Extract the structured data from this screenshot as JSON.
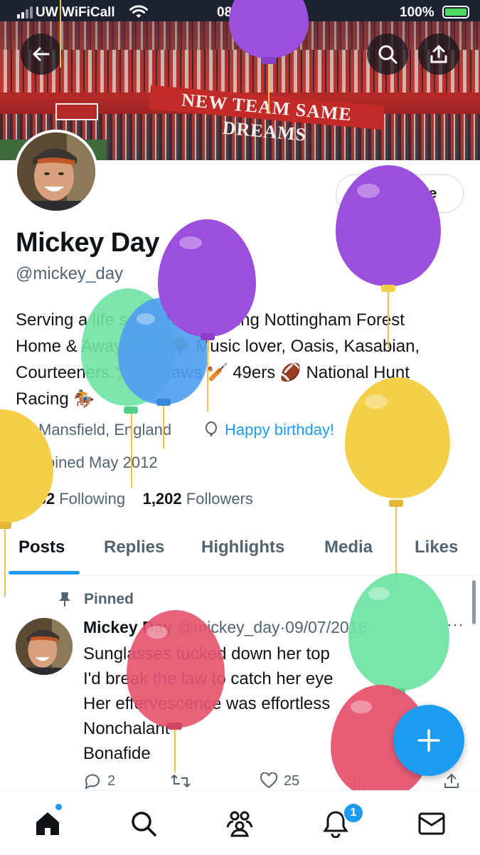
{
  "status_bar": {
    "carrier": "UW WiFiCall",
    "time": "08:03",
    "battery": "100%"
  },
  "banner": {
    "banner_text": "NEW TEAM SAME DREAMS"
  },
  "profile": {
    "edit_label": "Edit profile",
    "name": "Mickey Day",
    "handle": "@mickey_day",
    "bio_lines": [
      "Serving a life sentence following Nottingham Forest",
      "Home & Away 🌳🌳🌳 Music lover, Oasis, Kasabian,",
      "Courteeners.🏏 Outlaws 🏏 49ers 🏈 National Hunt",
      "Racing 🏇"
    ],
    "location": "Mansfield, England",
    "birthday": "Happy birthday!",
    "joined": "Joined May 2012",
    "following_count": "1,462",
    "following_label": "Following",
    "followers_count": "1,202",
    "followers_label": "Followers"
  },
  "tabs": [
    "Posts",
    "Replies",
    "Highlights",
    "Media",
    "Likes"
  ],
  "pinned_post": {
    "pinned_label": "Pinned",
    "author": "Mickey Day",
    "handle": "@mickey_day",
    "date": "09/07/2016",
    "lines": [
      "Sunglasses tucked down her top",
      "I'd break the law to catch her eye",
      "Her effervescence was effortless",
      "Nonchalant",
      "Bonafide"
    ],
    "replies": "2",
    "likes": "25"
  },
  "bottom_nav": {
    "notifications_badge": "1"
  },
  "balloon_colors": {
    "purple": "#9b4fdc",
    "green": "#6fe3a4",
    "blue": "#4f9ef0",
    "yellow": "#f4cf4a",
    "red": "#e6556f"
  },
  "accent": "#1d9bf0"
}
